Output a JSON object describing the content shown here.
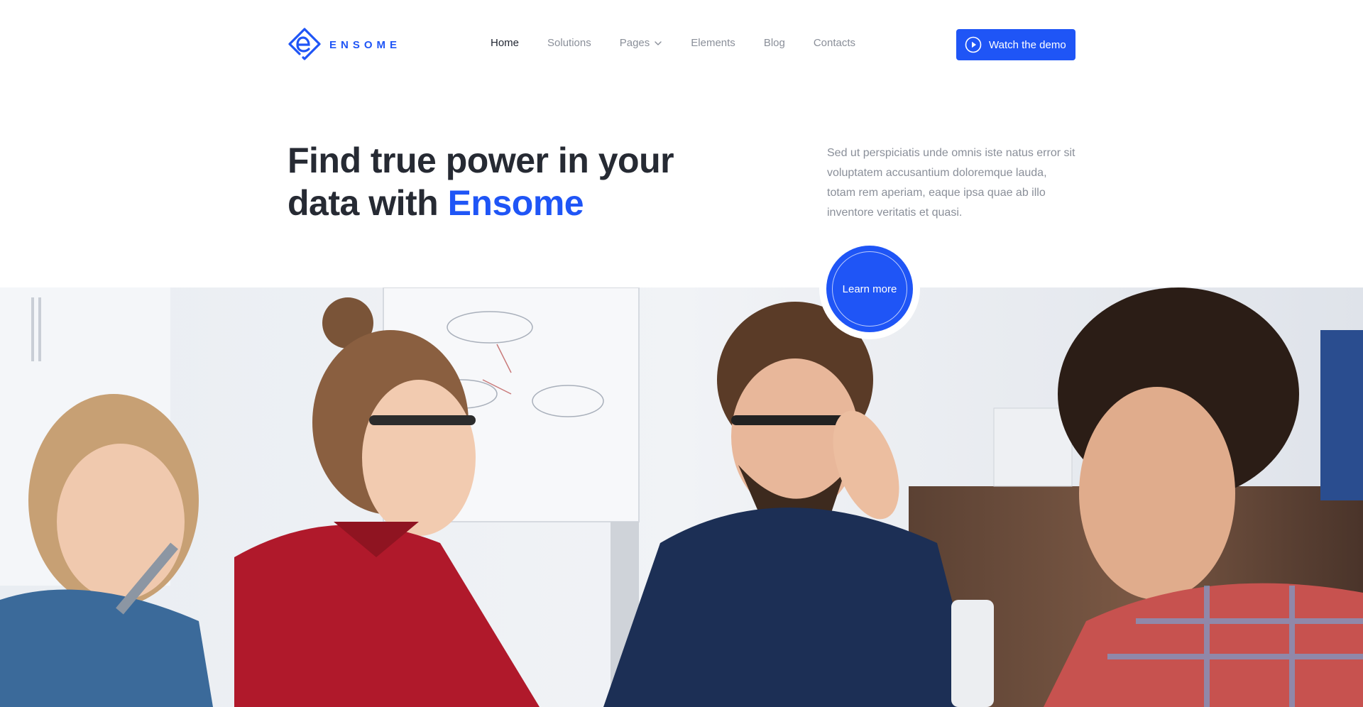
{
  "brand": {
    "name": "ENSOME",
    "accent_color": "#1f55f6"
  },
  "nav": {
    "items": [
      {
        "label": "Home",
        "active": true
      },
      {
        "label": "Solutions",
        "active": false
      },
      {
        "label": "Pages",
        "active": false,
        "has_dropdown": true
      },
      {
        "label": "Elements",
        "active": false
      },
      {
        "label": "Blog",
        "active": false
      },
      {
        "label": "Contacts",
        "active": false
      }
    ],
    "cta_label": "Watch the demo",
    "cta_icon": "play-circle-icon"
  },
  "hero": {
    "title_line1": "Find true power in your",
    "title_line2_prefix": "data with ",
    "title_accent": "Ensome",
    "description": "Sed ut perspiciatis unde omnis iste natus error sit voluptatem accusantium doloremque lauda, totam rem aperiam, eaque ipsa quae ab illo inventore veritatis et quasi.",
    "learn_more_label": "Learn more"
  }
}
